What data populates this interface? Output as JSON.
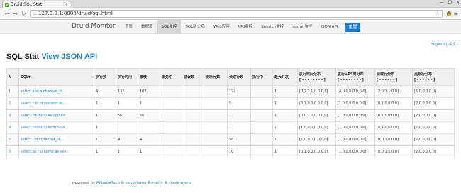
{
  "browser": {
    "tab_title": "Druid SQL Stat",
    "tab_favicon": "V",
    "url": "127.0.0.1:8080/druid/sql.html"
  },
  "nav": {
    "brand": "Druid Monitor",
    "items": [
      {
        "label": "首页"
      },
      {
        "label": "数据源"
      },
      {
        "label": "SQL监控"
      },
      {
        "label": "SQL防火墙"
      },
      {
        "label": "Web应用"
      },
      {
        "label": "URI监控"
      },
      {
        "label": "Session监控"
      },
      {
        "label": "spring监控"
      },
      {
        "label": "JSON API"
      }
    ],
    "reset_label": "重置"
  },
  "lang": {
    "english": "English",
    "sep": " | ",
    "chinese": "中文"
  },
  "page": {
    "title": "SQL Stat",
    "json_link": "View JSON API"
  },
  "table": {
    "headers": [
      "N",
      "SQL▼",
      "执行数",
      "执行时间",
      "最慢",
      "事务中",
      "错误数",
      "更新行数",
      "读取行数",
      "执行中",
      "最大并发",
      "执行时间分布\n[ - - - - - - - - ]",
      "执行+RS时分布\n[ - - - - - - - - ]",
      "读取行分布\n[ - - - - - - ]",
      "更新行分布\n[ - - - - - - ]"
    ],
    "rows": [
      [
        "1",
        "select a.id,a.channel_id,...",
        "4",
        "131",
        "102",
        "",
        "",
        "",
        "121",
        "",
        "1",
        "[0,2,1,1,0,0,0,0]",
        "[4,0,0,0,0,0,0,0]",
        "[2,0,1,1,0,0]",
        "[6,0,0,0,0,0]"
      ],
      [
        "2",
        "select c.id,ct.content as...",
        "1",
        "1",
        "1",
        "",
        "",
        "",
        "5",
        "",
        "1",
        "[0,1,0,0,0,0,0,0]",
        "[1,0,0,0,0,0,0,0]",
        "[0,1,0,0,0,0]",
        "[2,0,0,0,0,0]"
      ],
      [
        "3",
        "select count(*) as upload...",
        "1",
        "56",
        "56",
        "",
        "",
        "",
        "1",
        "",
        "1",
        "[0,0,1,0,0,0,0,0]",
        "[1,0,0,0,0,0,0,0]",
        "[0,1,0,0,0,0]",
        "[2,0,0,0,0,0]"
      ],
      [
        "4",
        "select count(*) from subt...",
        "1",
        "",
        "",
        "",
        "",
        "",
        "1",
        "",
        "1",
        "[1,0,0,0,0,0,0,0]",
        "[1,0,0,0,0,0,0,0]",
        "[0,1,0,0,0,0]",
        "[2,0,0,0,0,0]"
      ],
      [
        "5",
        "select i.id,i.channel_id,...",
        "1",
        "4",
        "4",
        "",
        "",
        "",
        "38",
        "",
        "1",
        "[1,0,0,0,0,0,0,0]",
        "[1,0,0,0,0,0,0,0]",
        "[0,0,1,0,0,0]",
        "[2,0,0,0,0,0]"
      ],
      [
        "6",
        "select su.*,u.name as use...",
        "1",
        "1",
        "1",
        "",
        "",
        "",
        "10",
        "",
        "1",
        "[0,1,0,0,0,0,0,0]",
        "[1,0,0,0,0,0,0,0]",
        "[0,0,1,0,0,0]",
        "[2,0,0,0,0,0]"
      ]
    ]
  },
  "footer": {
    "prefix": "powered by ",
    "link1": "AlibabaTech",
    "amp1": " & ",
    "link2": "sandzhang",
    "amp2": " & ",
    "link3": "melin",
    "amp3": " & ",
    "link4": "shrek.wang"
  }
}
